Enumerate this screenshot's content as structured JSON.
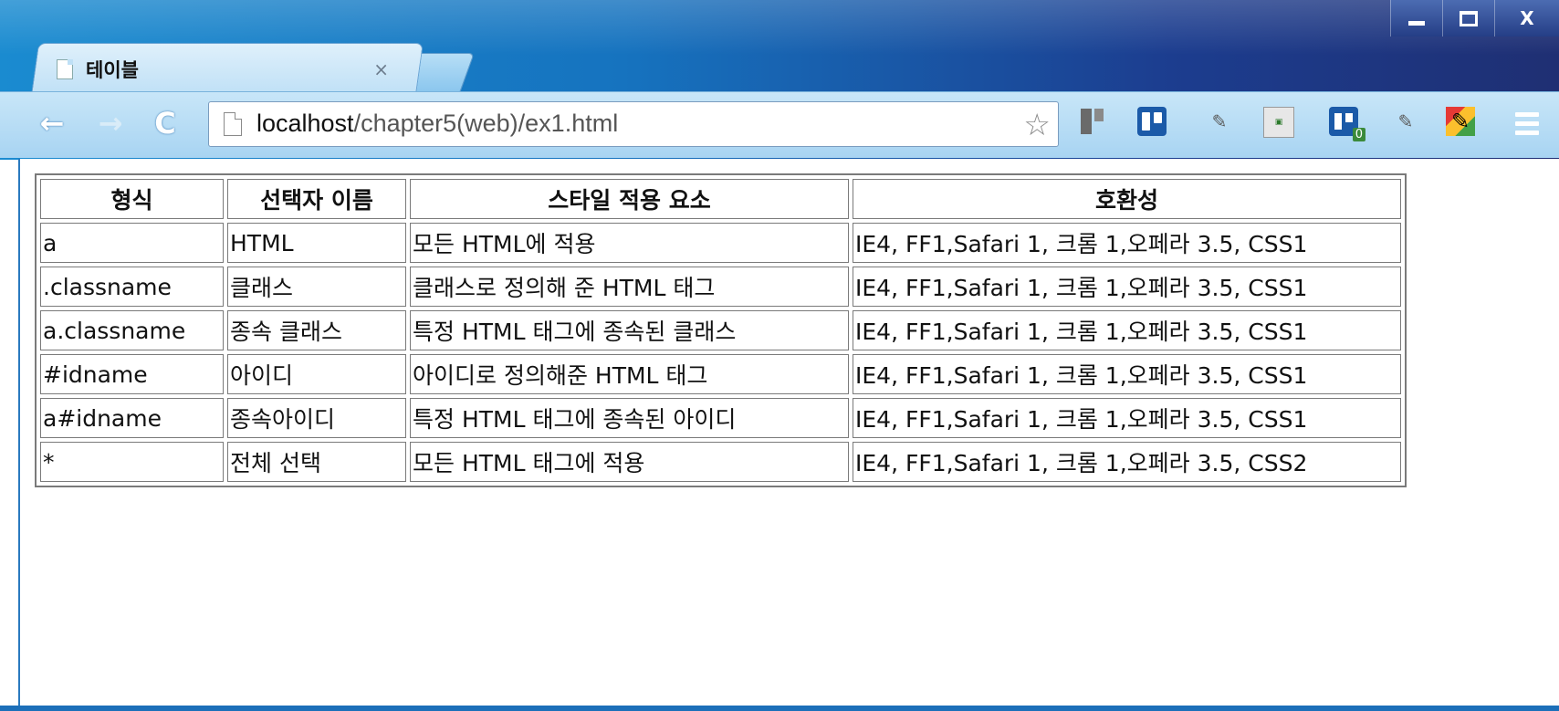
{
  "window": {
    "controls": {
      "minimize": "—",
      "maximize": "□",
      "close": "X"
    }
  },
  "tab": {
    "title": "테이블",
    "close": "×"
  },
  "toolbar": {
    "url_host": "localhost",
    "url_path": "/chapter5(web)/ex1.html",
    "back": "←",
    "forward": "→",
    "reload": "C"
  },
  "extensions": [
    "trello-icon",
    "trello-board-icon",
    "pen-icon",
    "fast-access-icon",
    "trello-badge-icon",
    "pen-icon-2",
    "colorful-pen-icon",
    "menu-icon"
  ],
  "extension_badge": "0",
  "table": {
    "headers": [
      "형식",
      "선택자 이름",
      "스타일 적용 요소",
      "호환성"
    ],
    "rows": [
      [
        "a",
        "HTML",
        "모든 HTML에 적용",
        "IE4, FF1,Safari 1, 크롬 1,오페라 3.5, CSS1"
      ],
      [
        ".classname",
        "클래스",
        "클래스로 정의해 준 HTML 태그",
        "IE4, FF1,Safari 1, 크롬 1,오페라 3.5, CSS1"
      ],
      [
        "a.classname",
        "종속 클래스",
        "특정 HTML 태그에 종속된 클래스",
        "IE4, FF1,Safari 1, 크롬 1,오페라 3.5, CSS1"
      ],
      [
        "#idname",
        "아이디",
        "아이디로 정의해준 HTML 태그",
        "IE4, FF1,Safari 1, 크롬 1,오페라 3.5, CSS1"
      ],
      [
        "a#idname",
        "종속아이디",
        "특정 HTML 태그에 종속된 아이디",
        "IE4, FF1,Safari 1, 크롬 1,오페라 3.5, CSS1"
      ],
      [
        "*",
        "전체 선택",
        "모든 HTML 태그에 적용",
        "IE4, FF1,Safari 1, 크롬 1,오페라 3.5, CSS2"
      ]
    ]
  }
}
